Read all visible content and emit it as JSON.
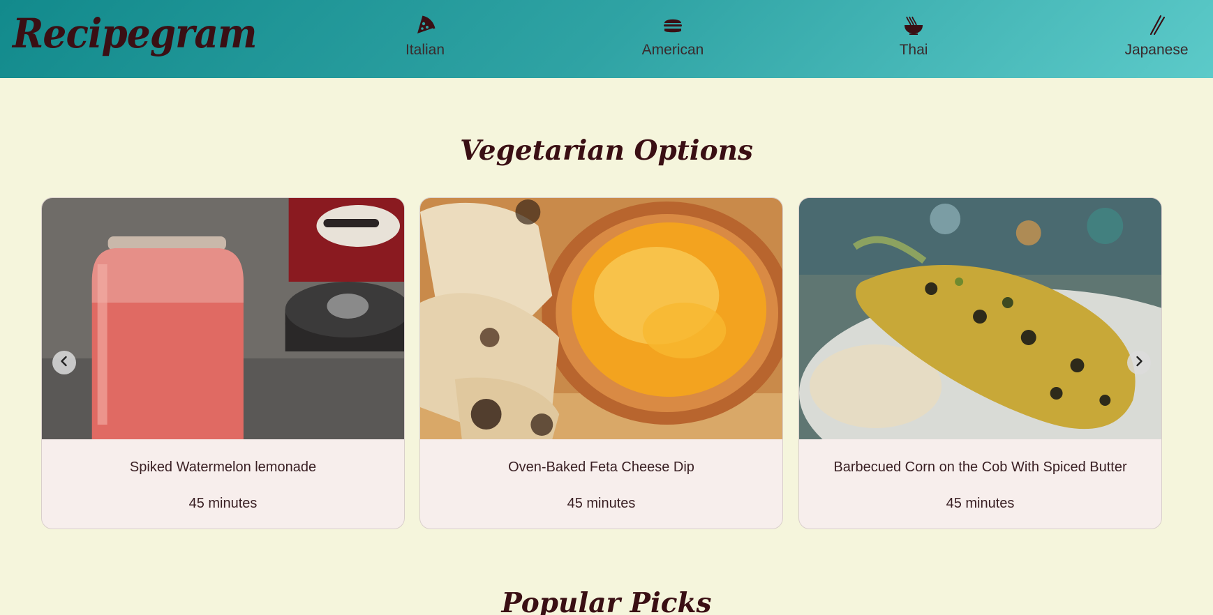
{
  "brand": {
    "logo": "Recipegram"
  },
  "nav": {
    "items": [
      {
        "label": "Italian",
        "icon": "pizza-icon"
      },
      {
        "label": "American",
        "icon": "burger-icon"
      },
      {
        "label": "Thai",
        "icon": "noodle-bowl-icon"
      },
      {
        "label": "Japanese",
        "icon": "chopsticks-icon"
      }
    ]
  },
  "sections": {
    "vegetarian": {
      "title": "Vegetarian Options",
      "cards": [
        {
          "title": "Spiked Watermelon lemonade",
          "time": "45 minutes"
        },
        {
          "title": "Oven-Baked Feta Cheese Dip",
          "time": "45 minutes"
        },
        {
          "title": "Barbecued Corn on the Cob With Spiced Butter",
          "time": "45 minutes"
        }
      ]
    },
    "popular": {
      "title": "Popular Picks"
    }
  },
  "carousel": {
    "prev_icon": "chevron-left-icon",
    "next_icon": "chevron-right-icon"
  },
  "colors": {
    "header_start": "#128a8c",
    "header_end": "#5ccac9",
    "page_bg": "#f5f5dc",
    "brand_text": "#3a0f14",
    "card_bg": "#f7eeec"
  }
}
